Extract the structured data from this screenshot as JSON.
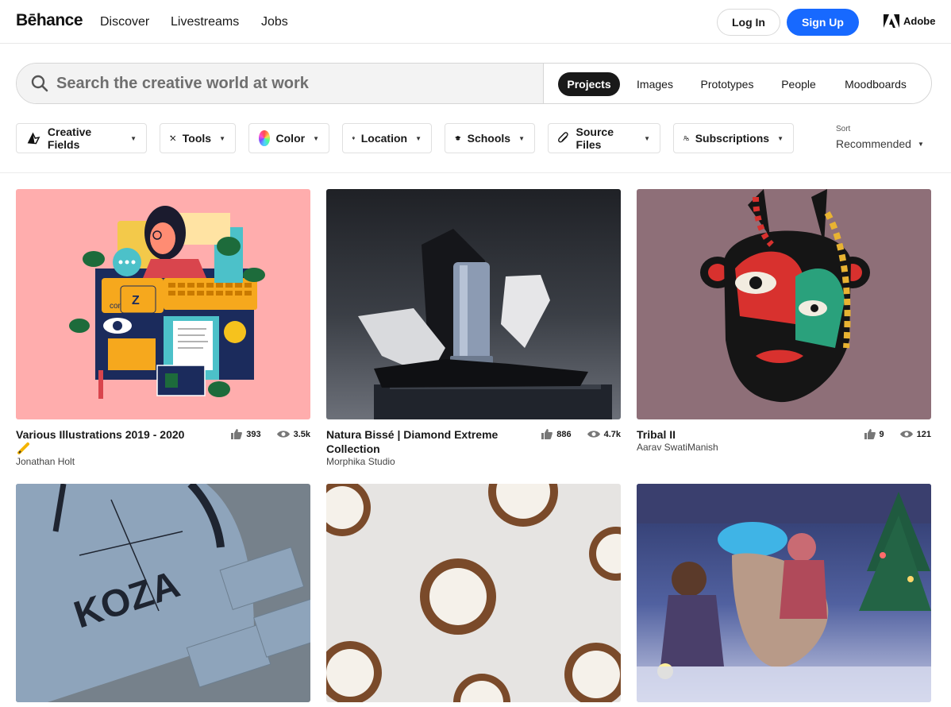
{
  "brand": {
    "logo": "Bēhance"
  },
  "nav": {
    "discover": "Discover",
    "livestreams": "Livestreams",
    "jobs": "Jobs",
    "login": "Log In",
    "signup": "Sign Up",
    "adobe": "Adobe"
  },
  "search": {
    "placeholder": "Search the creative world at work",
    "tabs": [
      "Projects",
      "Images",
      "Prototypes",
      "People",
      "Moodboards"
    ],
    "active_tab": "Projects"
  },
  "filters": {
    "creative_fields": "Creative Fields",
    "tools": "Tools",
    "color": "Color",
    "location": "Location",
    "schools": "Schools",
    "source_files": "Source Files",
    "subscriptions": "Subscriptions"
  },
  "sort": {
    "label": "Sort",
    "value": "Recommended"
  },
  "projects": [
    {
      "title": "Various Illustrations 2019 - 2020",
      "owner": "Jonathan Holt",
      "likes": "393",
      "views": "3.5k"
    },
    {
      "title": "Natura Bissé | Diamond Extreme Collection",
      "owner": "Morphika Studio",
      "likes": "886",
      "views": "4.7k"
    },
    {
      "title": "Tribal II",
      "owner": "Aarav SwatiManish",
      "likes": "9",
      "views": "121"
    },
    {
      "title": "",
      "owner": "",
      "likes": "",
      "views": ""
    },
    {
      "title": "",
      "owner": "",
      "likes": "",
      "views": ""
    },
    {
      "title": "",
      "owner": "",
      "likes": "",
      "views": ""
    }
  ],
  "artwork_text": {
    "illustration_command": "command",
    "illustration_z": "Z",
    "koza": "KOZA"
  },
  "colors": {
    "accent": "#1769ff",
    "text": "#191919",
    "card1_bg": "#ffadad",
    "card3_bg": "#8e6f78"
  }
}
